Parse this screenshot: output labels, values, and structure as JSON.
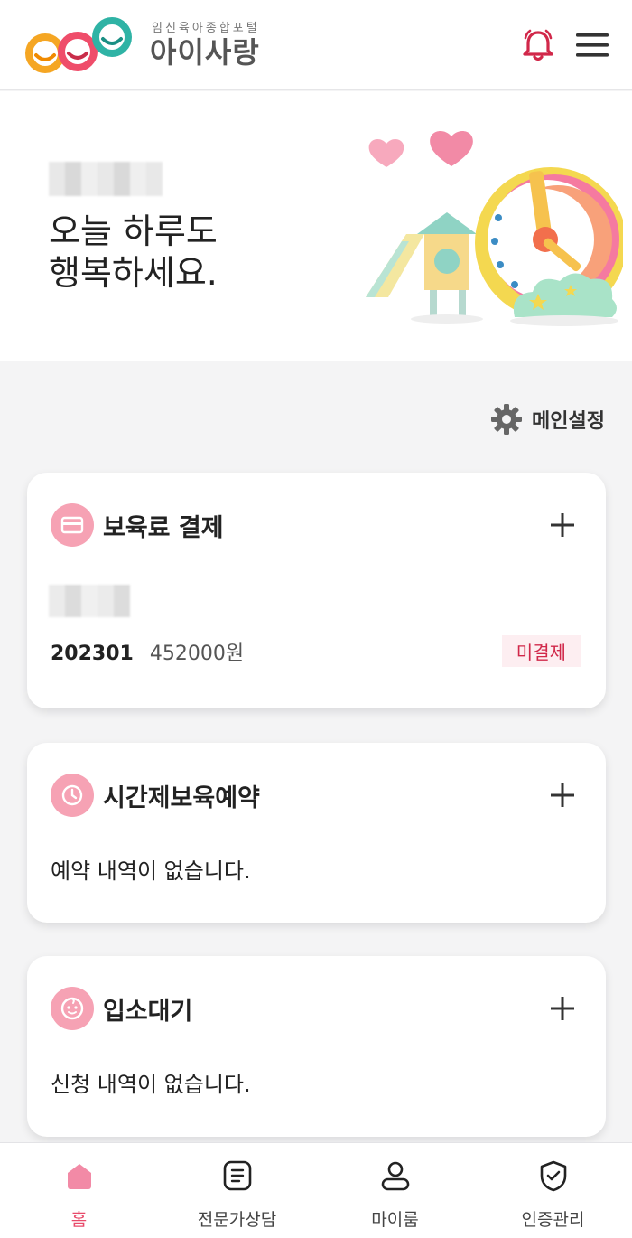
{
  "header": {
    "logo_sub": "임신육아종합포털",
    "logo_main": "아이사랑",
    "bell_icon": "bell-icon",
    "menu_icon": "hamburger-menu-icon",
    "accent": "#d1284a"
  },
  "hero": {
    "greeting": "오늘 하루도\n행복하세요."
  },
  "settings": {
    "label": "메인설정",
    "icon": "gear-icon"
  },
  "cards": {
    "payment": {
      "title": "보육료 결제",
      "icon": "credit-card-icon",
      "month": "202301",
      "amount": "452000원",
      "status": "미결제"
    },
    "reservation": {
      "title": "시간제보육예약",
      "icon": "clock-icon",
      "empty": "예약 내역이 없습니다."
    },
    "waiting": {
      "title": "입소대기",
      "icon": "baby-face-icon",
      "empty": "신청 내역이 없습니다."
    }
  },
  "nav": {
    "items": [
      {
        "label": "홈",
        "icon": "home-icon",
        "active": true
      },
      {
        "label": "전문가상담",
        "icon": "document-icon",
        "active": false
      },
      {
        "label": "마이룸",
        "icon": "person-icon",
        "active": false
      },
      {
        "label": "인증관리",
        "icon": "shield-check-icon",
        "active": false
      }
    ]
  },
  "colors": {
    "pink_icon_bg": "#f6a2b4",
    "status_red": "#d1284a",
    "nav_active": "#e84a6a"
  }
}
